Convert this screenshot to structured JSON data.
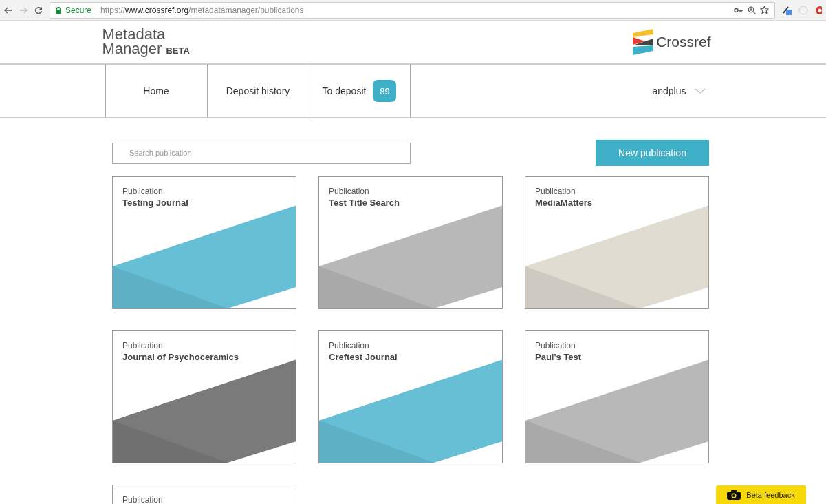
{
  "browser": {
    "secure_label": "Secure",
    "url": "https://**www.crossref.org**/metadatamanager/publications"
  },
  "header": {
    "app_title": "Metadata",
    "app_title_line2": "Manager",
    "beta": "BETA",
    "brand": "Crossref"
  },
  "nav": {
    "tabs": [
      {
        "label": "Home",
        "selected": false
      },
      {
        "label": "Deposit history",
        "selected": false
      },
      {
        "label": "To deposit",
        "selected": false,
        "badge": "89"
      }
    ],
    "user": "andplus"
  },
  "search": {
    "placeholder": "Search publication"
  },
  "new_button": "New publication",
  "publications": [
    {
      "label": "Publication",
      "title": "Testing Journal",
      "color": "#67bfd6"
    },
    {
      "label": "Publication",
      "title": "Test Title Search",
      "color": "#b8b8b8"
    },
    {
      "label": "Publication",
      "title": "MediaMatters",
      "color": "#e0dcd2"
    },
    {
      "label": "Publication",
      "title": "Journal of Psychoceramics",
      "color": "#7a7a7a"
    },
    {
      "label": "Publication",
      "title": "Creftest Journal",
      "color": "#67bfd6"
    },
    {
      "label": "Publication",
      "title": "Paul's Test",
      "color": "#b8b8b8"
    },
    {
      "label": "Publication"
    }
  ],
  "feedback_button": "Beta feedback"
}
